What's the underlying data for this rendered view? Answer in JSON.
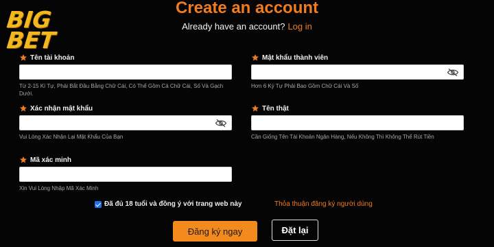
{
  "brand": {
    "line1": "BIG",
    "line2": "BET",
    "color": "#f3b81f"
  },
  "header": {
    "title": "Create an account",
    "question": "Already have an account?",
    "login_link": "Log in"
  },
  "fields": [
    {
      "label": "Tên tài khoản",
      "value": "",
      "hint": "Từ 2-15 Kí Tự, Phải Bắt Đầu Bằng Chữ Cái, Có Thể Gồm Cả Chữ Cái, Số Và Gạch Dưới.",
      "has_eye": false
    },
    {
      "label": "Mật khẩu thành viên",
      "value": "",
      "hint": "Hơn 6 Ký Tự Phải Bao Gồm Chữ Cái Và Số",
      "has_eye": true
    },
    {
      "label": "Xác nhận mật khẩu",
      "value": "",
      "hint": "Vui Lòng Xác Nhận Lại Mật Khẩu Của Bạn",
      "has_eye": true
    },
    {
      "label": "Tên thật",
      "value": "",
      "hint": "Cần Giống Tên Tài Khoản Ngân Hàng, Nếu Không Thì Không Thể Rút Tiền",
      "has_eye": false
    },
    {
      "label": "Mã xác minh",
      "value": "",
      "hint": "Xin Vui Lòng Nhập Mã Xác Minh",
      "has_eye": false
    }
  ],
  "agreement": {
    "checked": true,
    "text": "Đã đủ 18 tuổi và đồng ý với trang web này",
    "terms_link": "Thỏa thuận đăng ký người dùng"
  },
  "actions": {
    "register": "Đăng ký ngay",
    "reset": "Đặt lại"
  },
  "colors": {
    "accent": "#f07c20",
    "background": "#050505",
    "checkbox": "#1f6feb"
  },
  "icons": {
    "required": "star-icon",
    "toggle_password": "eye-slash-icon"
  }
}
